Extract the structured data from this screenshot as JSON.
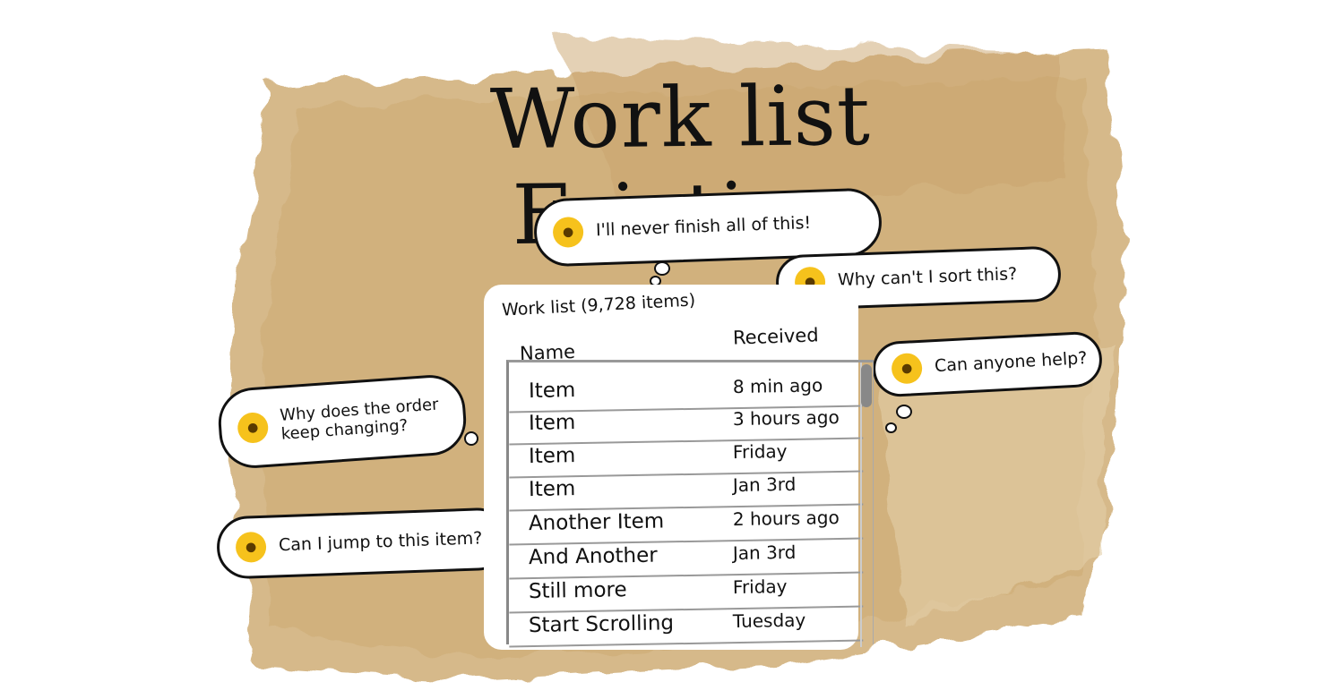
{
  "title": "Work list Friction",
  "list": {
    "title": "Work list (9,728 items)",
    "col_name": "Name",
    "col_received": "Received",
    "rows": [
      {
        "name": "Item",
        "received": "8 min ago"
      },
      {
        "name": "Item",
        "received": "3 hours ago"
      },
      {
        "name": "Item",
        "received": "Friday"
      },
      {
        "name": "Item",
        "received": "Jan 3rd"
      },
      {
        "name": "Another Item",
        "received": "2 hours ago"
      },
      {
        "name": "And Another",
        "received": "Jan 3rd"
      },
      {
        "name": "Still more",
        "received": "Friday"
      },
      {
        "name": "Start Scrolling",
        "received": "Tuesday"
      }
    ]
  },
  "bubbles": {
    "finish": {
      "text": "I'll never finish all of this!",
      "emoji": "screaming-face-icon"
    },
    "sort": {
      "text": "Why can't I sort this?",
      "emoji": "unamused-face-icon"
    },
    "help": {
      "text": "Can anyone help?",
      "emoji": "pleading-face-icon"
    },
    "order": {
      "text": "Why does the order keep changing?",
      "emoji": "raised-eyebrow-face-icon"
    },
    "jump": {
      "text": "Can I jump to this item?",
      "emoji": "confused-face-icon"
    }
  },
  "colors": {
    "paper": "#d9bd8f",
    "paper_dark": "#c9a46c",
    "emoji": "#f6c21c"
  }
}
